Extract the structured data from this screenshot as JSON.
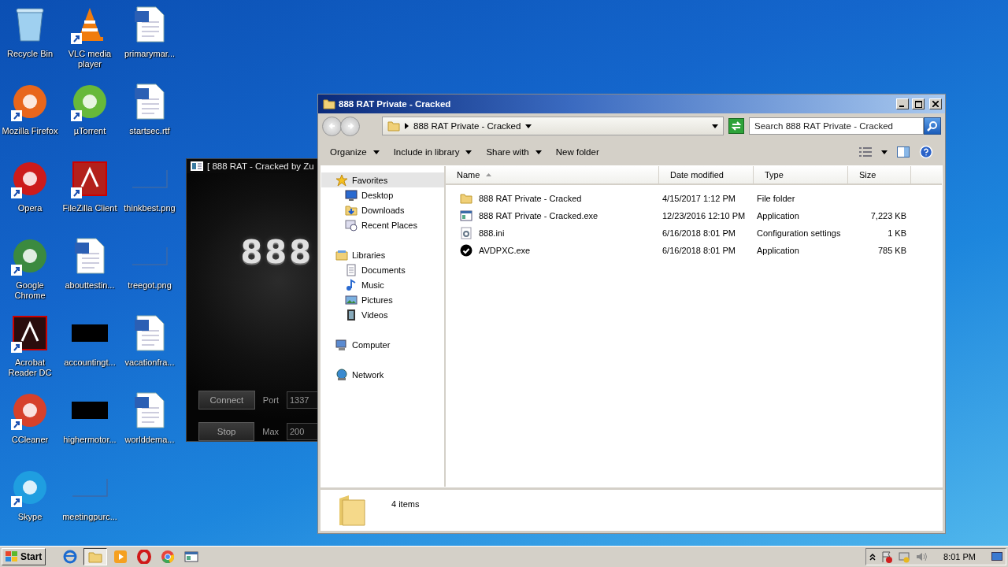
{
  "desktop": {
    "icons": [
      {
        "label": "Recycle Bin",
        "kind": "bin",
        "shortcut": false
      },
      {
        "label": "Mozilla Firefox",
        "kind": "round-app",
        "color": "#e8661c",
        "shortcut": true
      },
      {
        "label": "Opera",
        "kind": "round-app",
        "color": "#cc1b1b",
        "shortcut": true
      },
      {
        "label": "Google Chrome",
        "kind": "round-app",
        "color": "#3b8a3f",
        "shortcut": true
      },
      {
        "label": "Acrobat Reader DC",
        "kind": "square-app",
        "color": "#2a0d0d",
        "shortcut": true
      },
      {
        "label": "CCleaner",
        "kind": "round-app",
        "color": "#d6412b",
        "shortcut": true
      },
      {
        "label": "Skype",
        "kind": "round-app",
        "color": "#1f9ee0",
        "shortcut": true
      },
      {
        "label": "VLC media player",
        "kind": "cone-app",
        "color": "#f07c0e",
        "shortcut": true
      },
      {
        "label": "µTorrent",
        "kind": "round-app",
        "color": "#67b93a",
        "shortcut": true
      },
      {
        "label": "FileZilla Client",
        "kind": "square-app",
        "color": "#b3201b",
        "shortcut": true
      },
      {
        "label": "abouttestin...",
        "kind": "document",
        "shortcut": false
      },
      {
        "label": "accountingt...",
        "kind": "dark-image",
        "shortcut": false
      },
      {
        "label": "highermotor...",
        "kind": "dark-image",
        "shortcut": false
      },
      {
        "label": "meetingpurc...",
        "kind": "image",
        "shortcut": false
      },
      {
        "label": "primarymar...",
        "kind": "document",
        "shortcut": false
      },
      {
        "label": "startsec.rtf",
        "kind": "document",
        "shortcut": false
      },
      {
        "label": "thinkbest.png",
        "kind": "image",
        "shortcut": false
      },
      {
        "label": "treegot.png",
        "kind": "image",
        "shortcut": false
      },
      {
        "label": "vacationfra...",
        "kind": "document",
        "shortcut": false
      },
      {
        "label": "worlddema...",
        "kind": "document",
        "shortcut": false
      }
    ]
  },
  "rat_window": {
    "title": "[ 888 RAT - Cracked by Zu",
    "logo": "888",
    "buttons": [
      {
        "label": "Connect"
      },
      {
        "label": "Stop"
      }
    ],
    "fields": [
      {
        "label": "Port",
        "value": "1337"
      },
      {
        "label": "Max",
        "value": "200"
      }
    ]
  },
  "explorer": {
    "title": "888 RAT Private - Cracked",
    "address": {
      "path": "888 RAT Private - Cracked"
    },
    "search": {
      "placeholder": "Search 888 RAT Private - Cracked"
    },
    "commands": [
      {
        "label": "Organize",
        "dropdown": true
      },
      {
        "label": "Include in library",
        "dropdown": true
      },
      {
        "label": "Share with",
        "dropdown": true
      },
      {
        "label": "New folder",
        "dropdown": false
      }
    ],
    "nav": [
      {
        "label": "Favorites",
        "kind": "star",
        "selected": true,
        "children": [
          {
            "label": "Desktop",
            "kind": "desktop",
            "selected": false
          },
          {
            "label": "Downloads",
            "kind": "downloads",
            "selected": false
          },
          {
            "label": "Recent Places",
            "kind": "recent",
            "selected": false
          }
        ]
      },
      {
        "label": "Libraries",
        "kind": "library",
        "selected": false,
        "children": [
          {
            "label": "Documents",
            "kind": "documents",
            "selected": false
          },
          {
            "label": "Music",
            "kind": "music",
            "selected": false
          },
          {
            "label": "Pictures",
            "kind": "pictures",
            "selected": false
          },
          {
            "label": "Videos",
            "kind": "videos",
            "selected": false
          }
        ]
      },
      {
        "label": "Computer",
        "kind": "computer",
        "selected": false
      },
      {
        "label": "Network",
        "kind": "network",
        "selected": false
      }
    ],
    "columns": [
      {
        "label": "Name",
        "sorted": true
      },
      {
        "label": "Date modified",
        "sorted": false
      },
      {
        "label": "Type",
        "sorted": false
      },
      {
        "label": "Size",
        "sorted": false
      }
    ],
    "rows": [
      {
        "name": "888 RAT Private - Cracked",
        "date": "4/15/2017 1:12 PM",
        "type": "File folder",
        "size": "",
        "kind": "folder"
      },
      {
        "name": "888 RAT Private - Cracked.exe",
        "date": "12/23/2016 12:10 PM",
        "type": "Application",
        "size": "7,223 KB",
        "kind": "exe"
      },
      {
        "name": "888.ini",
        "date": "6/16/2018 8:01 PM",
        "type": "Configuration settings",
        "size": "1 KB",
        "kind": "settings"
      },
      {
        "name": "AVDPXC.exe",
        "date": "6/16/2018 8:01 PM",
        "type": "Application",
        "size": "785 KB",
        "kind": "check"
      }
    ],
    "status": "4 items"
  },
  "taskbar": {
    "start": "Start",
    "apps": [
      {
        "kind": "browser",
        "active": false
      },
      {
        "kind": "folder",
        "active": true
      },
      {
        "kind": "media",
        "active": false
      },
      {
        "kind": "opera",
        "active": false
      },
      {
        "kind": "chrome",
        "active": false
      },
      {
        "kind": "window",
        "active": false
      }
    ],
    "clock": "8:01 PM"
  }
}
